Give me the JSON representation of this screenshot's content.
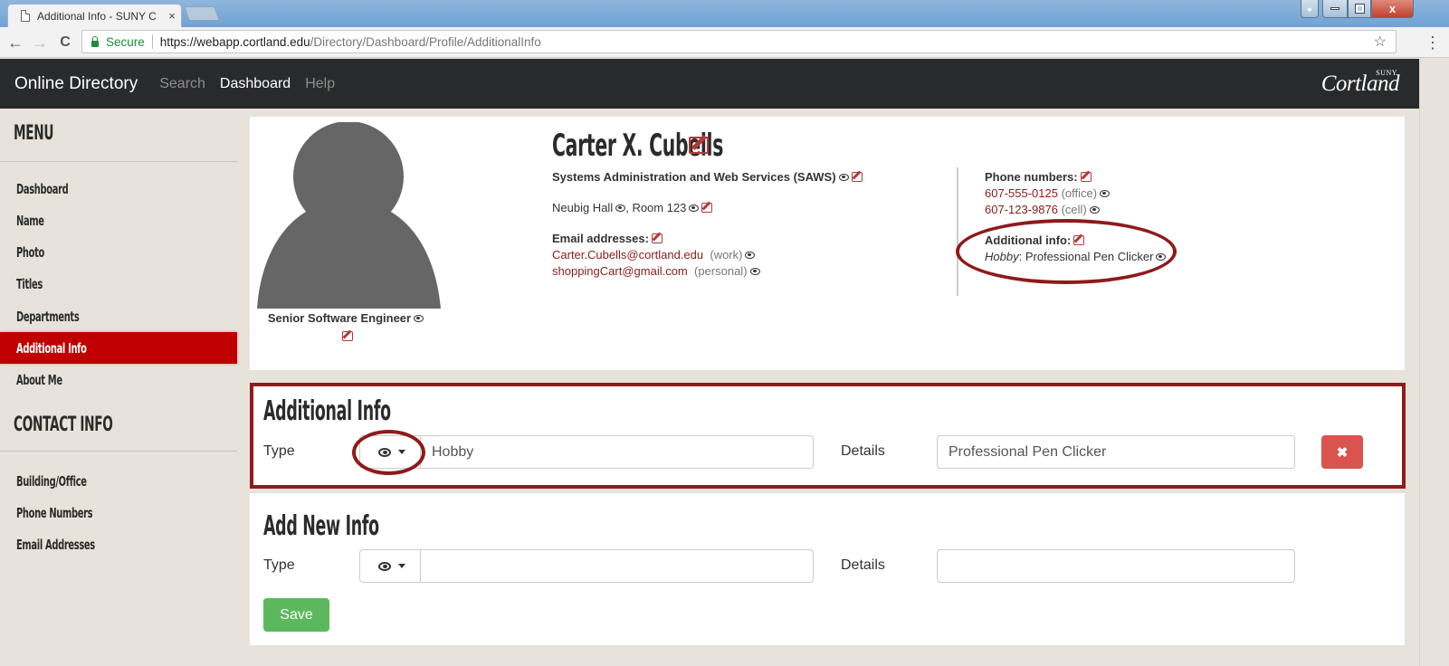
{
  "browser": {
    "tab_title": "Additional Info - SUNY C",
    "tab_close": "×",
    "secure_label": "Secure",
    "url_scheme_host": "https://webapp.cortland.edu",
    "url_path": "/Directory/Dashboard/Profile/AdditionalInfo",
    "back": "←",
    "forward": "→",
    "reload": "C",
    "bookmark_star": "☆",
    "menu_dots": "⋮",
    "window_close": "x",
    "window_minimize": "—",
    "window_maximize": "❐",
    "window_user": "👤"
  },
  "header": {
    "brand": "Online Directory",
    "nav": [
      {
        "label": "Search",
        "active": false
      },
      {
        "label": "Dashboard",
        "active": true
      },
      {
        "label": "Help",
        "active": false
      }
    ],
    "logo_main": "Cortland",
    "logo_suny": "SUNY"
  },
  "sidebar": {
    "menu_heading": "MENU",
    "menu_items": [
      {
        "label": "Dashboard",
        "active": false
      },
      {
        "label": "Name",
        "active": false
      },
      {
        "label": "Photo",
        "active": false
      },
      {
        "label": "Titles",
        "active": false
      },
      {
        "label": "Departments",
        "active": false
      },
      {
        "label": "Additional Info",
        "active": true
      },
      {
        "label": "About Me",
        "active": false
      }
    ],
    "contact_heading": "CONTACT INFO",
    "contact_items": [
      {
        "label": "Building/Office"
      },
      {
        "label": "Phone Numbers"
      },
      {
        "label": "Email Addresses"
      }
    ]
  },
  "profile": {
    "name": "Carter X. Cubells",
    "job_title": "Senior Software Engineer",
    "department": "Systems Administration and Web Services (SAWS)",
    "building": "Neubig Hall",
    "room": "Room  123",
    "email_label": "Email addresses:",
    "emails": [
      {
        "address": "Carter.Cubells@cortland.edu",
        "type": "(work)"
      },
      {
        "address": "shoppingCart@gmail.com",
        "type": "(personal)"
      }
    ],
    "phone_label": "Phone numbers:",
    "phones": [
      {
        "number": "607-555-0125",
        "type": "(office)"
      },
      {
        "number": "607-123-9876",
        "type": "(cell)"
      }
    ],
    "additional_label": "Additional info:",
    "additional_items": [
      {
        "type": "Hobby",
        "detail": "Professional Pen Clicker"
      }
    ]
  },
  "additional_info_form": {
    "heading": "Additional Info",
    "type_label": "Type",
    "type_value": "Hobby",
    "details_label": "Details",
    "details_value": "Professional Pen Clicker",
    "delete_icon": "✖"
  },
  "add_new_form": {
    "heading": "Add New Info",
    "type_label": "Type",
    "type_value": "",
    "details_label": "Details",
    "details_value": "",
    "save_label": "Save"
  },
  "colors": {
    "accent_red": "#c00000",
    "header_dark": "#292a2c",
    "link_red": "#8b1c1c",
    "save_green": "#5cb85c",
    "delete_red": "#d9534f",
    "annotation_red": "#8e1a1a"
  }
}
